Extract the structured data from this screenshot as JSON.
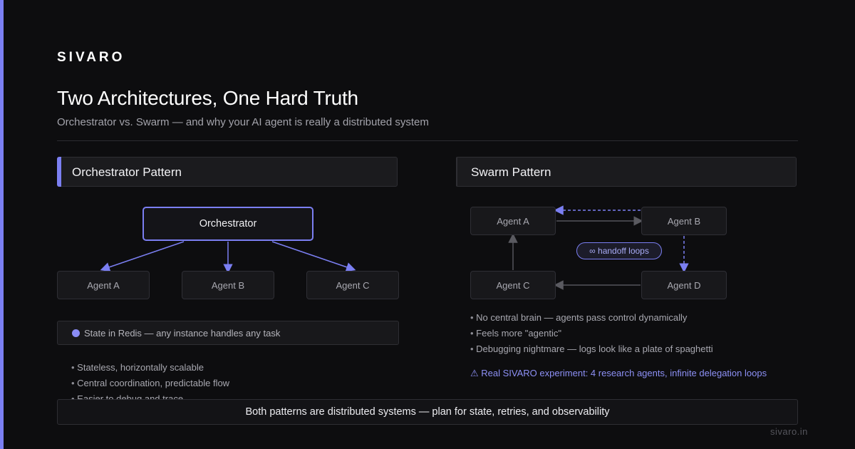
{
  "brand": "SIVARO",
  "title": "Two Architectures, One Hard Truth",
  "subtitle": "Orchestrator vs. Swarm — and why your AI agent is really a distributed system",
  "colors": {
    "accent": "#7b7ff2",
    "background": "#0d0d0f",
    "panel": "#1b1b1e",
    "warning": "#8d90f5"
  },
  "orchestrator": {
    "header": "Orchestrator Pattern",
    "root": "Orchestrator",
    "agents": [
      "Agent A",
      "Agent B",
      "Agent C"
    ],
    "state_icon": "dot-icon",
    "state_note": "State in Redis — any instance handles any task",
    "bullets": [
      "Stateless, horizontally scalable",
      "Central coordination, predictable flow",
      "Easier to debug and trace"
    ]
  },
  "swarm": {
    "header": "Swarm Pattern",
    "agents": [
      "Agent A",
      "Agent B",
      "Agent C",
      "Agent D"
    ],
    "handoff_label": "∞ handoff loops",
    "bullets": [
      "No central brain — agents pass control dynamically",
      "Feels more \"agentic\"",
      "Debugging nightmare — logs look like a plate of spaghetti"
    ],
    "warning": "⚠ Real SIVARO experiment: 4 research agents, infinite delegation loops"
  },
  "footer": "Both patterns are distributed systems — plan for state, retries, and observability",
  "site": "sivaro.in"
}
